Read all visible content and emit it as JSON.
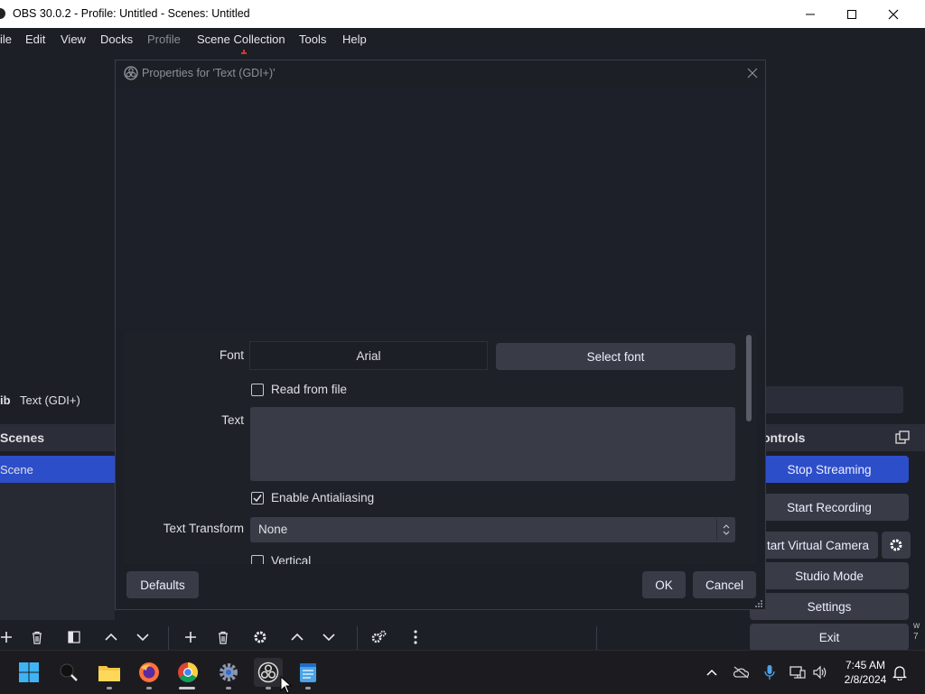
{
  "window": {
    "title": "OBS 30.0.2 - Profile: Untitled - Scenes: Untitled"
  },
  "menu": {
    "items": [
      "ile",
      "Edit",
      "View",
      "Docks",
      "Profile",
      "Scene Collection",
      "Tools",
      "Help"
    ]
  },
  "main": {
    "source_prefix": "ib",
    "source_name": "Text (GDI+)",
    "scenes_header": "Scenes",
    "scene_item": "Scene",
    "controls_header": "ontrols",
    "controls": {
      "stop_streaming": "Stop Streaming",
      "start_recording": "Start Recording",
      "start_virtual_camera": "tart Virtual Camera",
      "studio_mode": "Studio Mode",
      "settings": "Settings",
      "exit": "Exit"
    },
    "edge_text": "w 7"
  },
  "dialog": {
    "title": "Properties for 'Text (GDI+)'",
    "font_label": "Font",
    "font_value": "Arial",
    "select_font": "Select font",
    "read_from_file": "Read from file",
    "read_from_file_checked": false,
    "text_label": "Text",
    "text_value": "",
    "enable_antialiasing": "Enable Antialiasing",
    "enable_antialiasing_checked": true,
    "text_transform_label": "Text Transform",
    "text_transform_value": "None",
    "vertical": "Vertical",
    "defaults_button": "Defaults",
    "ok_button": "OK",
    "cancel_button": "Cancel"
  },
  "taskbar": {
    "time": "7:45 AM",
    "date": "2/8/2024"
  },
  "colors": {
    "accent": "#2d4ec9",
    "background": "#1d1f26",
    "button": "#393c47"
  }
}
